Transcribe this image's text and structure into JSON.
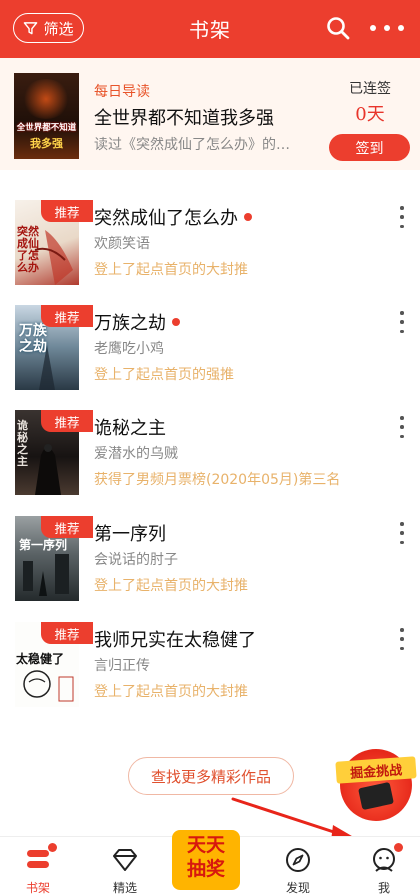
{
  "header": {
    "filter_label": "筛选",
    "title": "书架"
  },
  "daily": {
    "tag": "每日导读",
    "title": "全世界都不知道我多强",
    "desc": "读过《突然成仙了怎么办》的…",
    "cover_line1": "全世界都不知道",
    "cover_line2": "我多强",
    "streak_label": "已连签",
    "streak_value": "0天",
    "checkin_label": "签到"
  },
  "books": [
    {
      "title": "突然成仙了怎么办",
      "author": "欢颜笑语",
      "status": "登上了起点首页的大封推",
      "badge": "推荐",
      "updated": true,
      "cover_text": "突然成仙了怎么办"
    },
    {
      "title": "万族之劫",
      "author": "老鹰吃小鸡",
      "status": "登上了起点首页的强推",
      "badge": "推荐",
      "updated": true,
      "cover_text": "万族之劫"
    },
    {
      "title": "诡秘之主",
      "author": "爱潜水的乌贼",
      "status": "获得了男频月票榜(2020年05月)第三名",
      "badge": "推荐",
      "updated": false,
      "cover_text": "诡秘之主"
    },
    {
      "title": "第一序列",
      "author": "会说话的肘子",
      "status": "登上了起点首页的大封推",
      "badge": "推荐",
      "updated": false,
      "cover_text": "第一序列"
    },
    {
      "title": "我师兄实在太稳健了",
      "author": "言归正传",
      "status": "登上了起点首页的大封推",
      "badge": "推荐",
      "updated": false,
      "cover_text": "太稳健了"
    }
  ],
  "find_more": "查找更多精彩作品",
  "challenge_label": "掘金挑战",
  "lottery": {
    "line1": "天天",
    "line2": "抽奖"
  },
  "nav": {
    "bookshelf": "书架",
    "featured": "精选",
    "discover": "发现",
    "me": "我"
  },
  "colors": {
    "accent": "#ec3e2e",
    "status": "#e8b26a",
    "tag": "#e8542a"
  }
}
